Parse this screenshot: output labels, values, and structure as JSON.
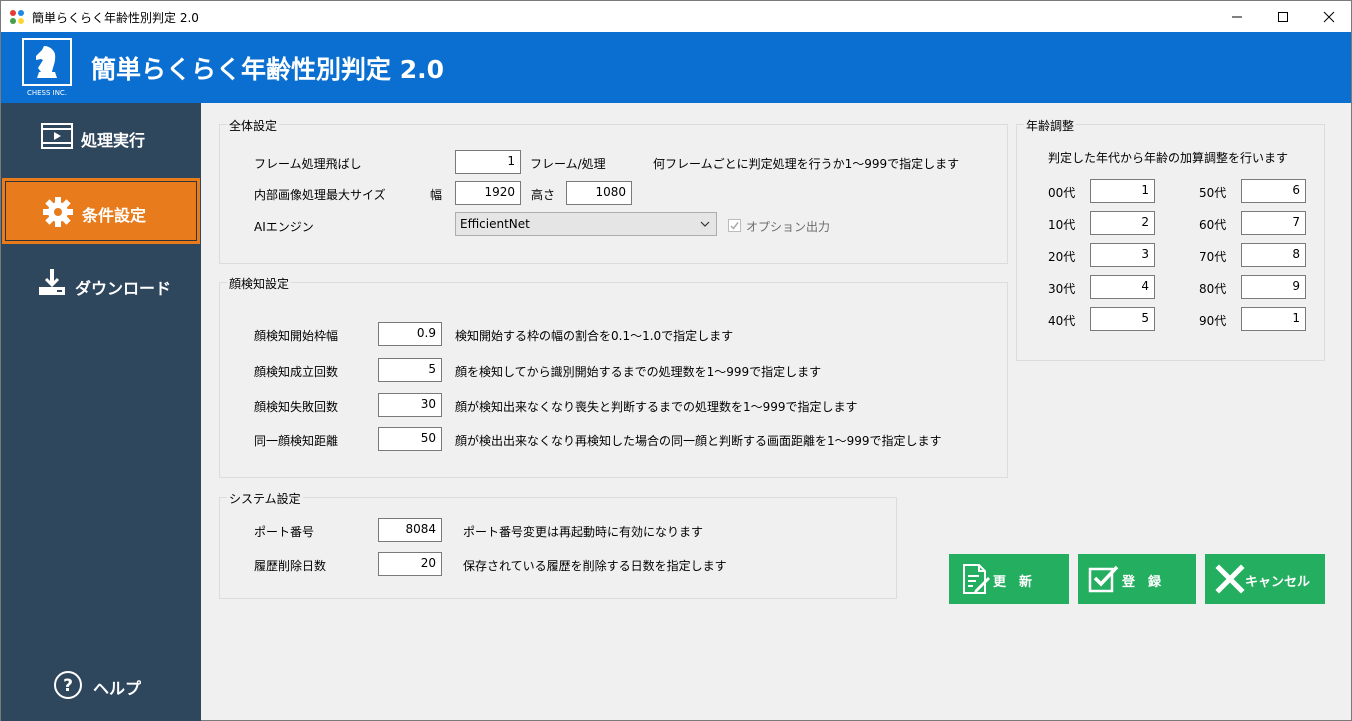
{
  "window": {
    "title": "簡単らくらく年齢性別判定 2.0",
    "minimize_glyph": "—",
    "maximize_glyph": "☐",
    "close_glyph": "✕"
  },
  "header": {
    "logo_text": "CHESS INC.",
    "title": "簡単らくらく年齢性別判定 2.0"
  },
  "sidebar": {
    "items": [
      {
        "label": "処理実行",
        "icon": "video-icon"
      },
      {
        "label": "条件設定",
        "icon": "gear-icon"
      },
      {
        "label": "ダウンロード",
        "icon": "download-icon"
      }
    ],
    "help_label": "ヘルプ"
  },
  "general": {
    "title": "全体設定",
    "frame_skip_label": "フレーム処理飛ばし",
    "frame_skip_value": "1",
    "frame_unit": "フレーム/処理",
    "frame_help": "何フレームごとに判定処理を行うか1～999で指定します",
    "max_size_label": "内部画像処理最大サイズ",
    "width_label": "幅",
    "width_value": "1920",
    "height_label": "高さ",
    "height_value": "1080",
    "ai_label": "AIエンジン",
    "ai_value": "EfficientNet",
    "option_label": "オプション出力",
    "option_checked": true
  },
  "face": {
    "title": "顔検知設定",
    "rows": [
      {
        "label": "顔検知開始枠幅",
        "value": "0.9",
        "help": "検知開始する枠の幅の割合を0.1～1.0で指定します"
      },
      {
        "label": "顔検知成立回数",
        "value": "5",
        "help": "顔を検知してから識別開始するまでの処理数を1～999で指定します"
      },
      {
        "label": "顔検知失敗回数",
        "value": "30",
        "help": "顔が検知出来なくなり喪失と判断するまでの処理数を1～999で指定します"
      },
      {
        "label": "同一顔検知距離",
        "value": "50",
        "help": "顔が検出出来なくなり再検知した場合の同一顔と判断する画面距離を1～999で指定します"
      }
    ]
  },
  "system": {
    "title": "システム設定",
    "rows": [
      {
        "label": "ポート番号",
        "value": "8084",
        "help": "ポート番号変更は再起動時に有効になります"
      },
      {
        "label": "履歴削除日数",
        "value": "20",
        "help": "保存されている履歴を削除する日数を指定します"
      }
    ]
  },
  "age": {
    "title": "年齢調整",
    "description": "判定した年代から年齢の加算調整を行います",
    "left": [
      {
        "label": "00代",
        "value": "1"
      },
      {
        "label": "10代",
        "value": "2"
      },
      {
        "label": "20代",
        "value": "3"
      },
      {
        "label": "30代",
        "value": "4"
      },
      {
        "label": "40代",
        "value": "5"
      }
    ],
    "right": [
      {
        "label": "50代",
        "value": "6"
      },
      {
        "label": "60代",
        "value": "7"
      },
      {
        "label": "70代",
        "value": "8"
      },
      {
        "label": "80代",
        "value": "9"
      },
      {
        "label": "90代",
        "value": "1"
      }
    ]
  },
  "actions": {
    "update_label": "更　新",
    "register_label": "登　録",
    "cancel_label": "キャンセル"
  },
  "colors": {
    "header": "#0a6fd1",
    "sidebar": "#2f475c",
    "active": "#e87b1c",
    "button": "#24ae5f"
  }
}
